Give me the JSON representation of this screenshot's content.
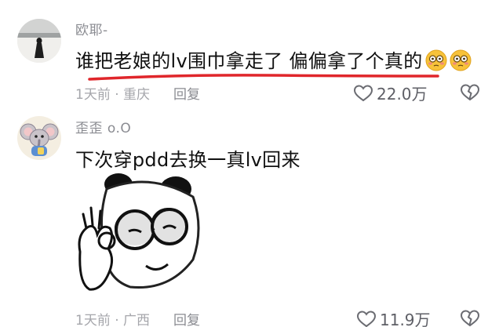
{
  "comments": [
    {
      "username": "欧耶-",
      "text": "谁把老娘的lv围巾拿走了 偏偏拿了个真的",
      "emojis": [
        "flushed-face-icon",
        "flushed-face-icon"
      ],
      "meta": "1天前 · 重庆",
      "reply_label": "回复",
      "likes": "22.0万",
      "underline_color": "#e0262b"
    },
    {
      "username": "歪歪 o.O",
      "text": "下次穿pdd去换一真lv回来",
      "sticker": "panda-meme-sticker",
      "meta": "1天前 · 广西",
      "reply_label": "回复",
      "likes": "11.9万"
    }
  ]
}
